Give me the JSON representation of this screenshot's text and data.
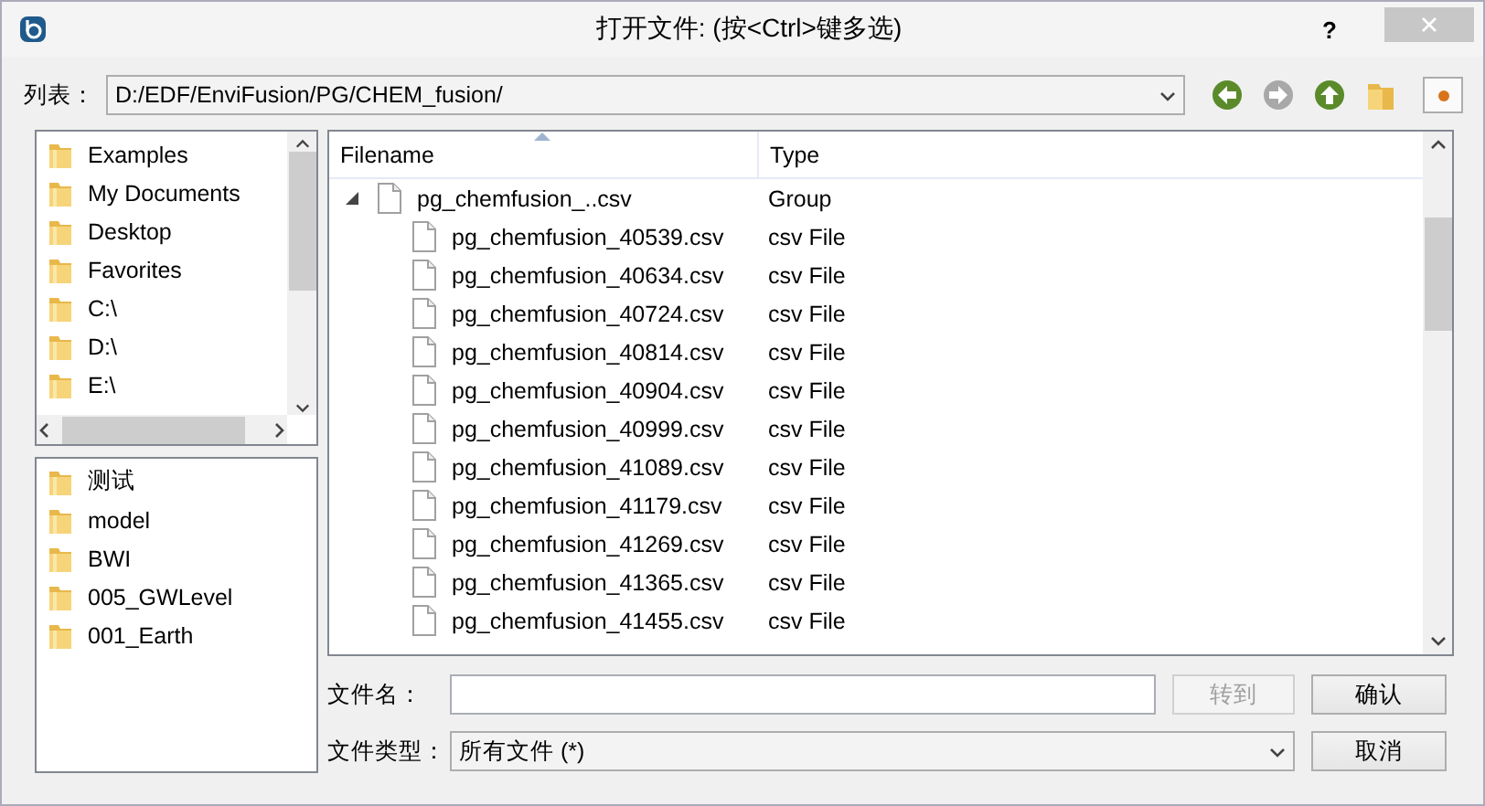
{
  "window": {
    "title": "打开文件: (按<Ctrl>键多选)",
    "help": "?"
  },
  "path_bar": {
    "label": "列表：",
    "value": "D:/EDF/EnviFusion/PG/CHEM_fusion/"
  },
  "places": [
    {
      "label": "Examples"
    },
    {
      "label": "My Documents"
    },
    {
      "label": "Desktop"
    },
    {
      "label": "Favorites"
    },
    {
      "label": "C:\\"
    },
    {
      "label": "D:\\"
    },
    {
      "label": "E:\\"
    }
  ],
  "recent": [
    {
      "label": "测试"
    },
    {
      "label": "model"
    },
    {
      "label": "BWI"
    },
    {
      "label": "005_GWLevel"
    },
    {
      "label": "001_Earth"
    }
  ],
  "file_list": {
    "columns": [
      "Filename",
      "Type"
    ],
    "rows": [
      {
        "kind": "group",
        "expanded": true,
        "name": "pg_chemfusion_..csv",
        "type": "Group"
      },
      {
        "kind": "file",
        "name": "pg_chemfusion_40539.csv",
        "type": "csv File"
      },
      {
        "kind": "file",
        "name": "pg_chemfusion_40634.csv",
        "type": "csv File"
      },
      {
        "kind": "file",
        "name": "pg_chemfusion_40724.csv",
        "type": "csv File"
      },
      {
        "kind": "file",
        "name": "pg_chemfusion_40814.csv",
        "type": "csv File"
      },
      {
        "kind": "file",
        "name": "pg_chemfusion_40904.csv",
        "type": "csv File"
      },
      {
        "kind": "file",
        "name": "pg_chemfusion_40999.csv",
        "type": "csv File"
      },
      {
        "kind": "file",
        "name": "pg_chemfusion_41089.csv",
        "type": "csv File"
      },
      {
        "kind": "file",
        "name": "pg_chemfusion_41179.csv",
        "type": "csv File"
      },
      {
        "kind": "file",
        "name": "pg_chemfusion_41269.csv",
        "type": "csv File"
      },
      {
        "kind": "file",
        "name": "pg_chemfusion_41365.csv",
        "type": "csv File"
      },
      {
        "kind": "file",
        "name": "pg_chemfusion_41455.csv",
        "type": "csv File"
      }
    ]
  },
  "filename": {
    "label": "文件名：",
    "goto_button": {
      "label": "转到",
      "disabled": true
    },
    "ok_button": {
      "label": "确认",
      "disabled": false
    }
  },
  "filetype": {
    "label": "文件类型：",
    "value": "所有文件 (*)",
    "cancel_button": {
      "label": "取消"
    }
  }
}
